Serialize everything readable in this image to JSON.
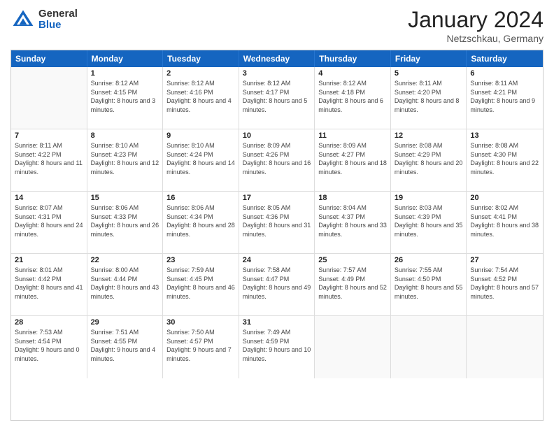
{
  "logo": {
    "general": "General",
    "blue": "Blue"
  },
  "header": {
    "month_year": "January 2024",
    "location": "Netzschkau, Germany"
  },
  "weekdays": [
    "Sunday",
    "Monday",
    "Tuesday",
    "Wednesday",
    "Thursday",
    "Friday",
    "Saturday"
  ],
  "weeks": [
    [
      {
        "day": "",
        "empty": true
      },
      {
        "day": "1",
        "sunrise": "Sunrise: 8:12 AM",
        "sunset": "Sunset: 4:15 PM",
        "daylight": "Daylight: 8 hours and 3 minutes."
      },
      {
        "day": "2",
        "sunrise": "Sunrise: 8:12 AM",
        "sunset": "Sunset: 4:16 PM",
        "daylight": "Daylight: 8 hours and 4 minutes."
      },
      {
        "day": "3",
        "sunrise": "Sunrise: 8:12 AM",
        "sunset": "Sunset: 4:17 PM",
        "daylight": "Daylight: 8 hours and 5 minutes."
      },
      {
        "day": "4",
        "sunrise": "Sunrise: 8:12 AM",
        "sunset": "Sunset: 4:18 PM",
        "daylight": "Daylight: 8 hours and 6 minutes."
      },
      {
        "day": "5",
        "sunrise": "Sunrise: 8:11 AM",
        "sunset": "Sunset: 4:20 PM",
        "daylight": "Daylight: 8 hours and 8 minutes."
      },
      {
        "day": "6",
        "sunrise": "Sunrise: 8:11 AM",
        "sunset": "Sunset: 4:21 PM",
        "daylight": "Daylight: 8 hours and 9 minutes."
      }
    ],
    [
      {
        "day": "7",
        "sunrise": "Sunrise: 8:11 AM",
        "sunset": "Sunset: 4:22 PM",
        "daylight": "Daylight: 8 hours and 11 minutes."
      },
      {
        "day": "8",
        "sunrise": "Sunrise: 8:10 AM",
        "sunset": "Sunset: 4:23 PM",
        "daylight": "Daylight: 8 hours and 12 minutes."
      },
      {
        "day": "9",
        "sunrise": "Sunrise: 8:10 AM",
        "sunset": "Sunset: 4:24 PM",
        "daylight": "Daylight: 8 hours and 14 minutes."
      },
      {
        "day": "10",
        "sunrise": "Sunrise: 8:09 AM",
        "sunset": "Sunset: 4:26 PM",
        "daylight": "Daylight: 8 hours and 16 minutes."
      },
      {
        "day": "11",
        "sunrise": "Sunrise: 8:09 AM",
        "sunset": "Sunset: 4:27 PM",
        "daylight": "Daylight: 8 hours and 18 minutes."
      },
      {
        "day": "12",
        "sunrise": "Sunrise: 8:08 AM",
        "sunset": "Sunset: 4:29 PM",
        "daylight": "Daylight: 8 hours and 20 minutes."
      },
      {
        "day": "13",
        "sunrise": "Sunrise: 8:08 AM",
        "sunset": "Sunset: 4:30 PM",
        "daylight": "Daylight: 8 hours and 22 minutes."
      }
    ],
    [
      {
        "day": "14",
        "sunrise": "Sunrise: 8:07 AM",
        "sunset": "Sunset: 4:31 PM",
        "daylight": "Daylight: 8 hours and 24 minutes."
      },
      {
        "day": "15",
        "sunrise": "Sunrise: 8:06 AM",
        "sunset": "Sunset: 4:33 PM",
        "daylight": "Daylight: 8 hours and 26 minutes."
      },
      {
        "day": "16",
        "sunrise": "Sunrise: 8:06 AM",
        "sunset": "Sunset: 4:34 PM",
        "daylight": "Daylight: 8 hours and 28 minutes."
      },
      {
        "day": "17",
        "sunrise": "Sunrise: 8:05 AM",
        "sunset": "Sunset: 4:36 PM",
        "daylight": "Daylight: 8 hours and 31 minutes."
      },
      {
        "day": "18",
        "sunrise": "Sunrise: 8:04 AM",
        "sunset": "Sunset: 4:37 PM",
        "daylight": "Daylight: 8 hours and 33 minutes."
      },
      {
        "day": "19",
        "sunrise": "Sunrise: 8:03 AM",
        "sunset": "Sunset: 4:39 PM",
        "daylight": "Daylight: 8 hours and 35 minutes."
      },
      {
        "day": "20",
        "sunrise": "Sunrise: 8:02 AM",
        "sunset": "Sunset: 4:41 PM",
        "daylight": "Daylight: 8 hours and 38 minutes."
      }
    ],
    [
      {
        "day": "21",
        "sunrise": "Sunrise: 8:01 AM",
        "sunset": "Sunset: 4:42 PM",
        "daylight": "Daylight: 8 hours and 41 minutes."
      },
      {
        "day": "22",
        "sunrise": "Sunrise: 8:00 AM",
        "sunset": "Sunset: 4:44 PM",
        "daylight": "Daylight: 8 hours and 43 minutes."
      },
      {
        "day": "23",
        "sunrise": "Sunrise: 7:59 AM",
        "sunset": "Sunset: 4:45 PM",
        "daylight": "Daylight: 8 hours and 46 minutes."
      },
      {
        "day": "24",
        "sunrise": "Sunrise: 7:58 AM",
        "sunset": "Sunset: 4:47 PM",
        "daylight": "Daylight: 8 hours and 49 minutes."
      },
      {
        "day": "25",
        "sunrise": "Sunrise: 7:57 AM",
        "sunset": "Sunset: 4:49 PM",
        "daylight": "Daylight: 8 hours and 52 minutes."
      },
      {
        "day": "26",
        "sunrise": "Sunrise: 7:55 AM",
        "sunset": "Sunset: 4:50 PM",
        "daylight": "Daylight: 8 hours and 55 minutes."
      },
      {
        "day": "27",
        "sunrise": "Sunrise: 7:54 AM",
        "sunset": "Sunset: 4:52 PM",
        "daylight": "Daylight: 8 hours and 57 minutes."
      }
    ],
    [
      {
        "day": "28",
        "sunrise": "Sunrise: 7:53 AM",
        "sunset": "Sunset: 4:54 PM",
        "daylight": "Daylight: 9 hours and 0 minutes."
      },
      {
        "day": "29",
        "sunrise": "Sunrise: 7:51 AM",
        "sunset": "Sunset: 4:55 PM",
        "daylight": "Daylight: 9 hours and 4 minutes."
      },
      {
        "day": "30",
        "sunrise": "Sunrise: 7:50 AM",
        "sunset": "Sunset: 4:57 PM",
        "daylight": "Daylight: 9 hours and 7 minutes."
      },
      {
        "day": "31",
        "sunrise": "Sunrise: 7:49 AM",
        "sunset": "Sunset: 4:59 PM",
        "daylight": "Daylight: 9 hours and 10 minutes."
      },
      {
        "day": "",
        "empty": true
      },
      {
        "day": "",
        "empty": true
      },
      {
        "day": "",
        "empty": true
      }
    ]
  ]
}
